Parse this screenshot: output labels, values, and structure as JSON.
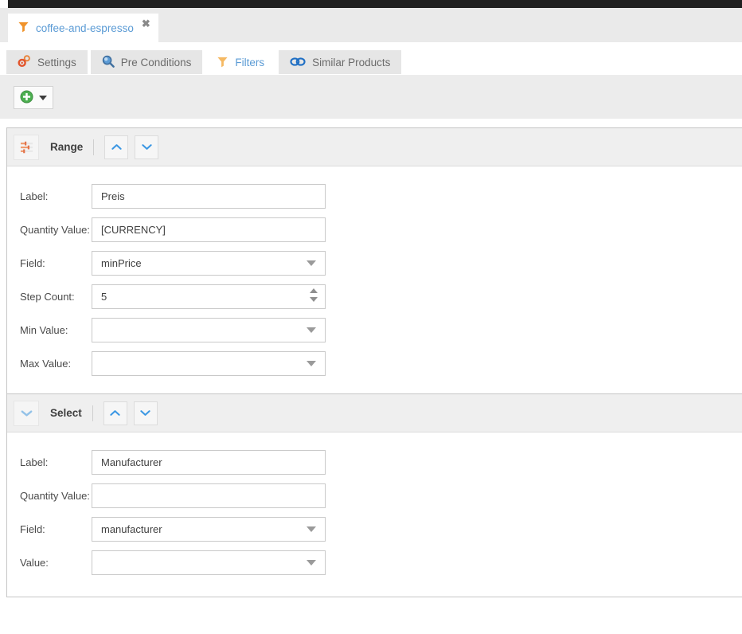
{
  "window_tab": {
    "label": "coffee-and-espresso",
    "close_label": "✖",
    "icon": "funnel-icon"
  },
  "nav_tabs": [
    {
      "label": "Settings",
      "icon": "gears-icon",
      "active": false
    },
    {
      "label": "Pre Conditions",
      "icon": "magnifier-icon",
      "active": false
    },
    {
      "label": "Filters",
      "icon": "funnel-icon",
      "active": true
    },
    {
      "label": "Similar Products",
      "icon": "chain-link-icon",
      "active": false
    }
  ],
  "toolbar": {
    "add_button": {
      "icon": "plus-circle-icon",
      "dropdown_icon": "caret-down-icon"
    }
  },
  "panels": [
    {
      "title": "Range",
      "icon": "sliders-icon",
      "move_up_icon": "chevron-up-icon",
      "move_down_icon": "chevron-down-icon",
      "fields": [
        {
          "label": "Label:",
          "value": "Preis",
          "type": "text"
        },
        {
          "label": "Quantity Value:",
          "value": "[CURRENCY]",
          "type": "text"
        },
        {
          "label": "Field:",
          "value": "minPrice",
          "type": "select"
        },
        {
          "label": "Step Count:",
          "value": "5",
          "type": "number"
        },
        {
          "label": "Min Value:",
          "value": "",
          "type": "select"
        },
        {
          "label": "Max Value:",
          "value": "",
          "type": "select"
        }
      ]
    },
    {
      "title": "Select",
      "icon": "chevron-down-icon",
      "move_up_icon": "chevron-up-icon",
      "move_down_icon": "chevron-down-icon",
      "fields": [
        {
          "label": "Label:",
          "value": "Manufacturer",
          "type": "text"
        },
        {
          "label": "Quantity Value:",
          "value": "",
          "type": "text"
        },
        {
          "label": "Field:",
          "value": "manufacturer",
          "type": "select"
        },
        {
          "label": "Value:",
          "value": "",
          "type": "select"
        }
      ]
    }
  ],
  "colors": {
    "accent_orange": "#f0932b",
    "link_blue": "#5b9bd5",
    "chevron_blue": "#3b97e3",
    "add_green": "#4caf50",
    "top_strip": "#212121"
  }
}
